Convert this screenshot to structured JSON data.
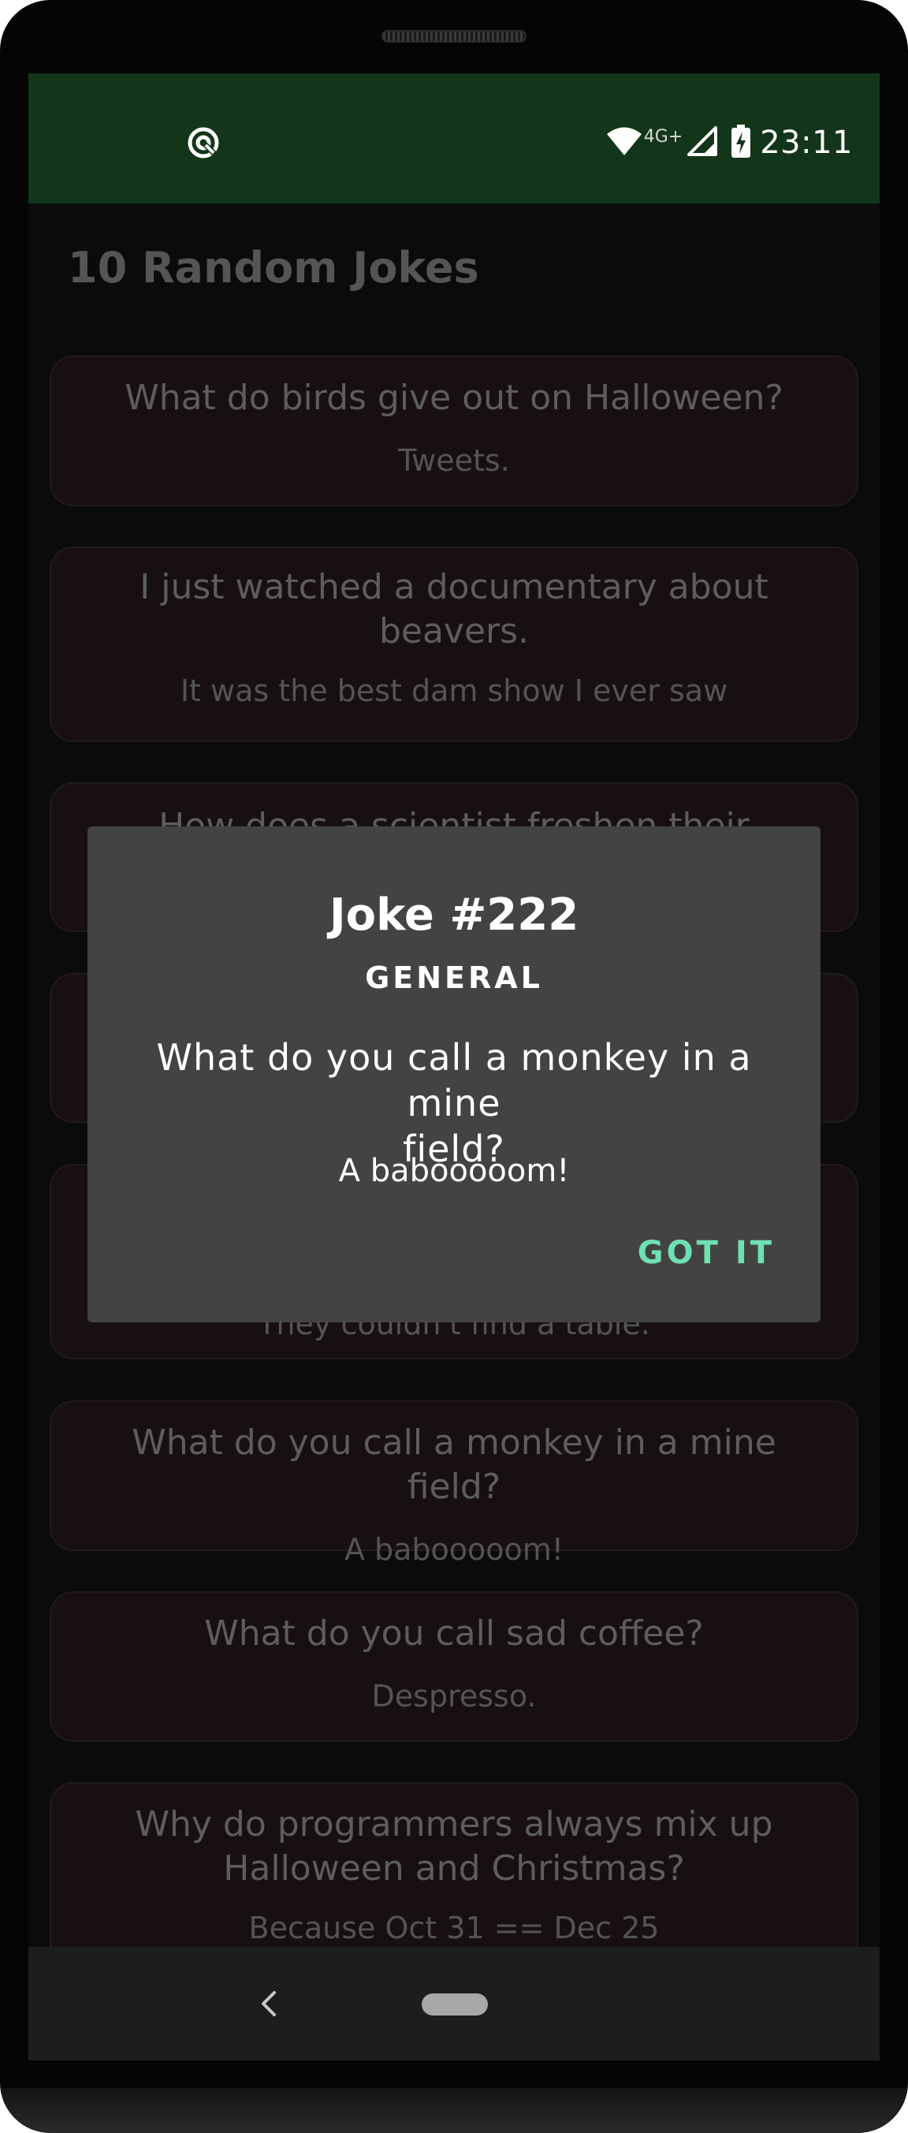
{
  "status_bar": {
    "network_label": "4G+",
    "time": "23:11",
    "color": "#133519"
  },
  "app": {
    "title": "10 Random Jokes"
  },
  "jokes": [
    {
      "setup_lines": [
        "What do birds give out on Halloween?"
      ],
      "punchline": "Tweets."
    },
    {
      "setup_lines": [
        "I just watched a documentary about",
        "beavers."
      ],
      "punchline": "It was the best dam show I ever saw"
    },
    {
      "setup_lines": [
        "How does a scientist freshen their breath?"
      ],
      "punchline": ""
    },
    {
      "setup_lines": [
        ""
      ],
      "punchline": ""
    },
    {
      "setup_lines": [
        ""
      ],
      "punchline": "They couldn't find a table."
    },
    {
      "setup_lines": [
        "What do you call a monkey in a mine field?"
      ],
      "punchline": "A babooooom!"
    },
    {
      "setup_lines": [
        "What do you call sad coffee?"
      ],
      "punchline": "Despresso."
    },
    {
      "setup_lines": [
        "Why do programmers always mix up",
        "Halloween and Christmas?"
      ],
      "punchline": "Because Oct 31 == Dec 25"
    }
  ],
  "dialog": {
    "title": "Joke #222",
    "category": "GENERAL",
    "question_lines": [
      "What do you call a monkey in a mine",
      "field?"
    ],
    "answer": "A babooooom!",
    "button_label": "GOT IT",
    "accent_color": "#6fe0b2"
  },
  "nav": {
    "back_icon": "back-chevron-icon",
    "home_icon": "home-pill-icon"
  }
}
